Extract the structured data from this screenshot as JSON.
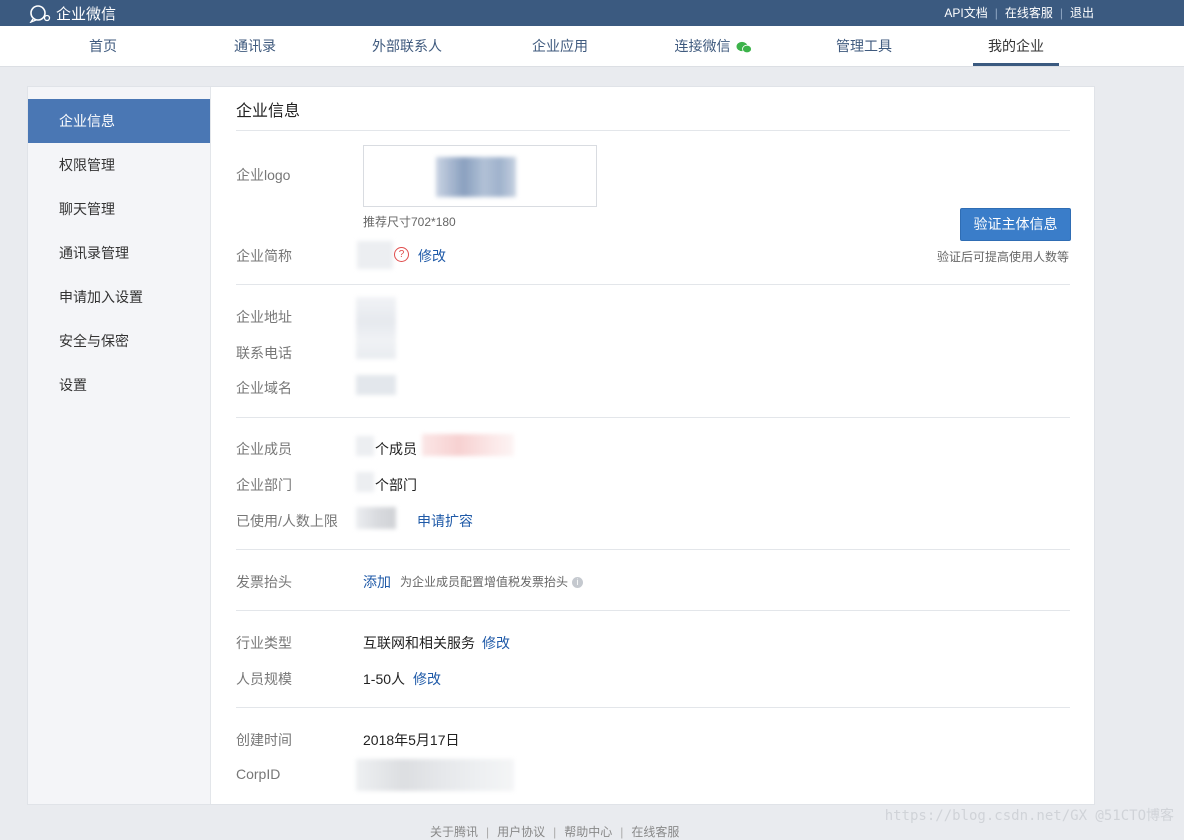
{
  "app": {
    "title": "企业微信"
  },
  "toplinks": {
    "api": "API文档",
    "service": "在线客服",
    "logout": "退出"
  },
  "nav": {
    "items": [
      "首页",
      "通讯录",
      "外部联系人",
      "企业应用",
      "连接微信",
      "管理工具",
      "我的企业"
    ],
    "active": "我的企业"
  },
  "sidebar": {
    "items": [
      "企业信息",
      "权限管理",
      "聊天管理",
      "通讯录管理",
      "申请加入设置",
      "安全与保密",
      "设置"
    ],
    "active": "企业信息"
  },
  "main": {
    "title": "企业信息",
    "logo_label": "企业logo",
    "logo_hint": "推荐尺寸702*180",
    "verify_button": "验证主体信息",
    "verify_hint": "验证后可提高使用人数等",
    "short_name_label": "企业简称",
    "short_name_edit": "修改",
    "address_label": "企业地址",
    "phone_label": "联系电话",
    "domain_label": "企业域名",
    "members_label": "企业成员",
    "members_suffix": "个成员",
    "departments_label": "企业部门",
    "departments_suffix": "个部门",
    "usage_label": "已使用/人数上限",
    "usage_action": "申请扩容",
    "invoice_label": "发票抬头",
    "invoice_action": "添加",
    "invoice_hint": "为企业成员配置增值税发票抬头",
    "industry_label": "行业类型",
    "industry_value": "互联网和相关服务",
    "industry_edit": "修改",
    "scale_label": "人员规模",
    "scale_value": "1-50人",
    "scale_edit": "修改",
    "created_label": "创建时间",
    "created_value": "2018年5月17日",
    "corpid_label": "CorpID"
  },
  "footer": {
    "links": [
      "关于腾讯",
      "用户协议",
      "帮助中心",
      "在线客服"
    ]
  },
  "watermark": "https://blog.csdn.net/GX @51CTO博客",
  "colors": {
    "topbar": "#3b5a80",
    "accent": "#4a77b4",
    "link": "#1f5aa8",
    "button": "#3a7dc9"
  }
}
